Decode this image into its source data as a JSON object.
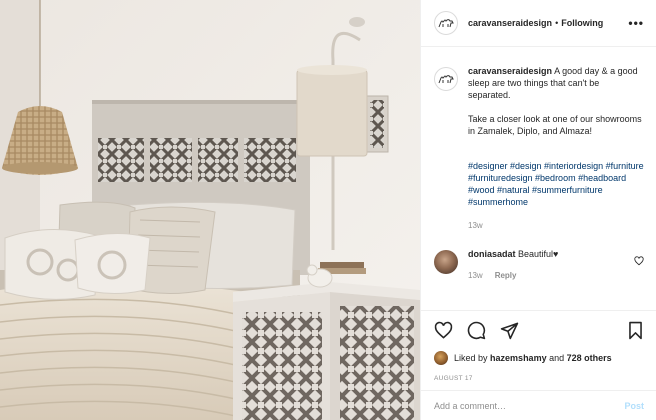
{
  "post": {
    "image_alt": "Bedroom with carved wooden headboard, woven pendant lamp, wall lamp and lattice nightstand",
    "colors": {
      "link": "#00376b",
      "muted": "#8e8e8e",
      "post_button": "#b2dffc",
      "text": "#262626"
    }
  },
  "header": {
    "username": "caravanseraidesign",
    "separator": "•",
    "follow_status": "Following",
    "more_icon": "more-horizontal-icon",
    "more_label": "•••"
  },
  "caption": {
    "username": "caravanseraidesign",
    "line1": "A good day & a good sleep are two things that can't be separated.",
    "line2": "Take a closer look at one of our showrooms in Zamalek, Diplo, and Almaza!",
    "hashtags": "#designer #design #interiordesign #furniture #furnituredesign #bedroom #headboard #wood #natural #summerfurniture #summerhome",
    "time": "13w"
  },
  "comment": {
    "username": "doniasadat",
    "text": "Beautiful♥",
    "time": "13w",
    "reply_label": "Reply"
  },
  "actions": {
    "like_icon": "heart-icon",
    "comment_icon": "comment-icon",
    "share_icon": "share-icon",
    "save_icon": "bookmark-icon"
  },
  "likes": {
    "prefix": "Liked by",
    "user": "hazemshamy",
    "conjunction": "and",
    "others": "728 others"
  },
  "date": "AUGUST 17",
  "add_comment": {
    "placeholder": "Add a comment…",
    "post_label": "Post"
  }
}
